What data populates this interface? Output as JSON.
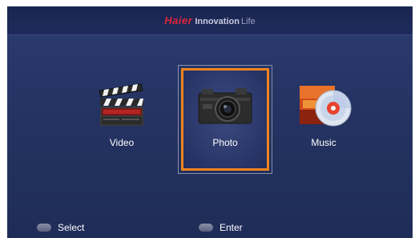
{
  "header": {
    "brand": "Haier",
    "slogan": "Innovation",
    "slogan_tail": "Life"
  },
  "menu": {
    "items": [
      {
        "label": "Video",
        "icon": "clapperboard-icon",
        "selected": false
      },
      {
        "label": "Photo",
        "icon": "camera-icon",
        "selected": true
      },
      {
        "label": "Music",
        "icon": "music-cd-icon",
        "selected": false
      }
    ]
  },
  "footer": {
    "hints": [
      {
        "label": "Select",
        "key": "navigate-key-icon"
      },
      {
        "label": "Enter",
        "key": "ok-key-icon"
      }
    ]
  },
  "colors": {
    "background": "#243362",
    "focus": "#f0841e",
    "brand": "#e0253a"
  }
}
